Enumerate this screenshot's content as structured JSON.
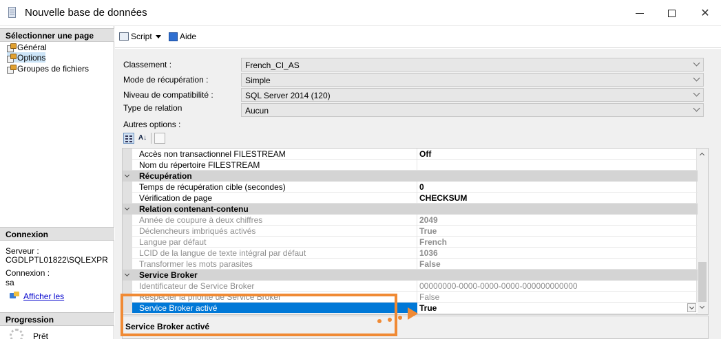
{
  "window": {
    "title": "Nouvelle base de données",
    "minimize_label": "",
    "maximize_label": "",
    "close_label": "✕"
  },
  "left": {
    "select_page_header": "Sélectionner une page",
    "pages": [
      {
        "label": "Général",
        "selected": false
      },
      {
        "label": "Options",
        "selected": true
      },
      {
        "label": "Groupes de fichiers",
        "selected": false
      }
    ],
    "connection_header": "Connexion",
    "server_label": "Serveur :",
    "server_value": "CGDLPTL01822\\SQLEXPR",
    "connection_label": "Connexion :",
    "connection_value": "sa",
    "view_link": "Afficher les",
    "progress_header": "Progression",
    "progress_status": "Prêt"
  },
  "toolbar": {
    "script_label": "Script",
    "help_label": "Aide"
  },
  "form": {
    "collation_label": "Classement :",
    "collation_value": "French_CI_AS",
    "recovery_label": "Mode de récupération :",
    "recovery_value": "Simple",
    "compat_label": "Niveau de compatibilité :",
    "compat_value": "SQL Server 2014 (120)",
    "containment_label": "Type de relation",
    "containment_value": "Aucun",
    "other_options_label": "Autres options :"
  },
  "grid": {
    "rows": [
      {
        "type": "prop",
        "name": "Accès non transactionnel FILESTREAM",
        "value": "Off",
        "bold": true,
        "readonly": false
      },
      {
        "type": "prop",
        "name": "Nom du répertoire FILESTREAM",
        "value": "",
        "bold": false,
        "readonly": false
      },
      {
        "type": "cat",
        "name": "Récupération"
      },
      {
        "type": "prop",
        "name": "Temps de récupération cible (secondes)",
        "value": "0",
        "bold": true,
        "readonly": false
      },
      {
        "type": "prop",
        "name": "Vérification de page",
        "value": "CHECKSUM",
        "bold": true,
        "readonly": false
      },
      {
        "type": "cat",
        "name": "Relation contenant-contenu"
      },
      {
        "type": "prop",
        "name": "Année de coupure à deux chiffres",
        "value": "2049",
        "bold": true,
        "readonly": true
      },
      {
        "type": "prop",
        "name": "Déclencheurs imbriqués activés",
        "value": "True",
        "bold": true,
        "readonly": true
      },
      {
        "type": "prop",
        "name": "Langue par défaut",
        "value": "French",
        "bold": true,
        "readonly": true
      },
      {
        "type": "prop",
        "name": "LCID de la langue de texte intégral par défaut",
        "value": "1036",
        "bold": true,
        "readonly": true
      },
      {
        "type": "prop",
        "name": "Transformer les mots parasites",
        "value": "False",
        "bold": true,
        "readonly": true
      },
      {
        "type": "cat",
        "name": "Service Broker"
      },
      {
        "type": "prop",
        "name": "Identificateur de Service Broker",
        "value": "00000000-0000-0000-0000-000000000000",
        "bold": false,
        "readonly": true
      },
      {
        "type": "prop",
        "name": "Respecter la priorité de Service Broker",
        "value": "False",
        "bold": false,
        "readonly": true
      },
      {
        "type": "prop",
        "name": "Service Broker activé",
        "value": "True",
        "bold": true,
        "readonly": false,
        "selected": true
      }
    ]
  },
  "description": {
    "title": "Service Broker activé"
  },
  "colors": {
    "selection": "#0078d7",
    "annotation": "#f08a34"
  }
}
